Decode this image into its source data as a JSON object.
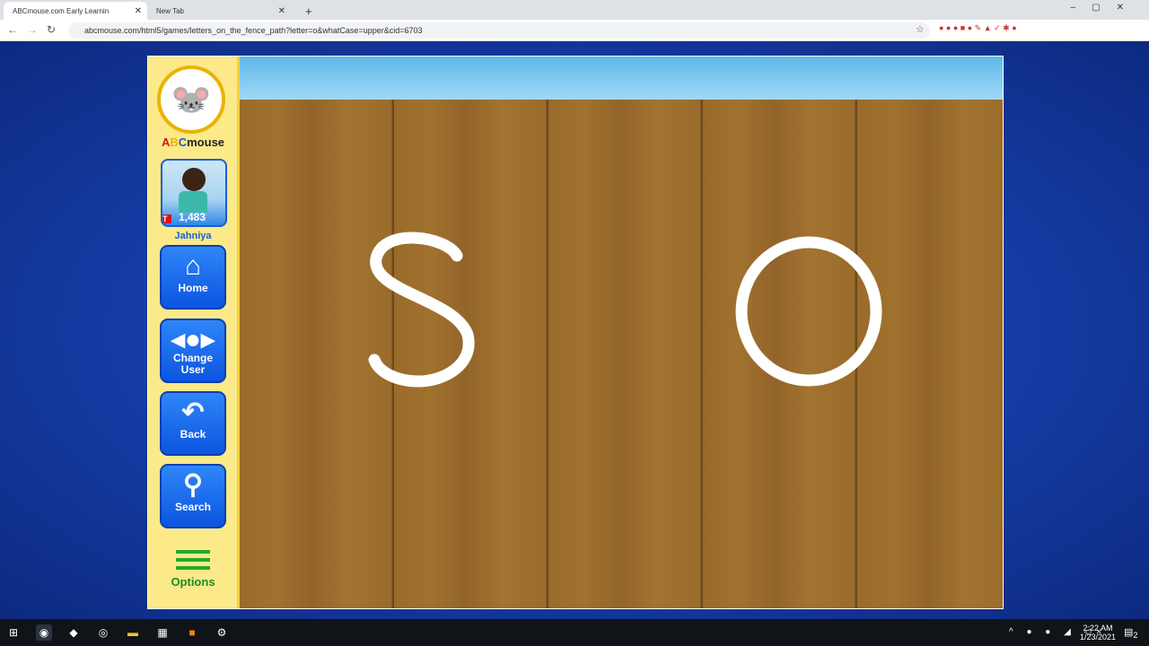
{
  "browser": {
    "tabs": [
      {
        "title": "ABCmouse.com Early Learnin",
        "active": true
      },
      {
        "title": "New Tab",
        "active": false
      }
    ],
    "url": "abcmouse.com/html5/games/letters_on_the_fence_path?letter=o&whatCase=upper&cid=6703"
  },
  "sidebar": {
    "brand": "ABCmouse",
    "user": {
      "name": "Jahniya",
      "tickets": "1,483",
      "badge": "T"
    },
    "buttons": [
      {
        "label": "Home",
        "icon": "home-icon"
      },
      {
        "label": "Change User",
        "icon": "change-user-icon"
      },
      {
        "label": "Back",
        "icon": "back-arrow-icon"
      },
      {
        "label": "Search",
        "icon": "search-icon"
      }
    ],
    "options_label": "Options"
  },
  "game": {
    "letters": [
      "S",
      "O"
    ],
    "letter_color": "#ffffff",
    "fence_color": "#9a6a2a"
  },
  "taskbar": {
    "time": "2:22 AM",
    "date": "1/23/2021",
    "notifications": "2"
  }
}
